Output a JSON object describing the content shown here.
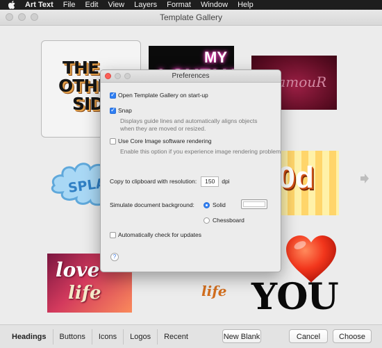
{
  "menubar": {
    "app_name": "Art Text",
    "items": [
      "File",
      "Edit",
      "View",
      "Layers",
      "Format",
      "Window",
      "Help"
    ]
  },
  "window": {
    "title": "Template Gallery"
  },
  "gallery": {
    "thumbs": {
      "other_side": [
        "THE",
        "OTHER",
        "SID"
      ],
      "my_lovely": [
        "MY",
        "LOVELY"
      ],
      "glamour": "GlamouR",
      "splash": "SPLASH",
      "ood": "00d",
      "love": "love",
      "life": "life",
      "life_small": "life",
      "you": "YOU"
    },
    "next_arrow_icon": "arrow-right-icon"
  },
  "bottombar": {
    "tabs": [
      "Headings",
      "Buttons",
      "Icons",
      "Logos",
      "Recent"
    ],
    "active_tab": "Headings",
    "new_blank": "New Blank",
    "cancel": "Cancel",
    "choose": "Choose"
  },
  "preferences": {
    "title": "Preferences",
    "open_gallery": {
      "label": "Open Template Gallery on start-up",
      "checked": true
    },
    "snap": {
      "label": "Snap",
      "checked": true,
      "hint": "Displays guide lines and automatically aligns objects when they are moved or resized."
    },
    "core_image": {
      "label": "Use Core Image software rendering",
      "checked": false,
      "hint": "Enable this option if you experience image rendering problems."
    },
    "clipboard": {
      "label": "Copy to clipboard with resolution:",
      "value": "150",
      "unit": "dpi"
    },
    "background": {
      "label": "Simulate document background:",
      "options": [
        "Solid",
        "Chessboard"
      ],
      "selected": "Solid",
      "color": "#ffffff"
    },
    "updates": {
      "label": "Automatically check for updates",
      "checked": false
    },
    "help": "?"
  },
  "colors": {
    "accent": "#2f7ff4",
    "close_button": "#fc5f57",
    "menubar": "#1e1e1e"
  }
}
